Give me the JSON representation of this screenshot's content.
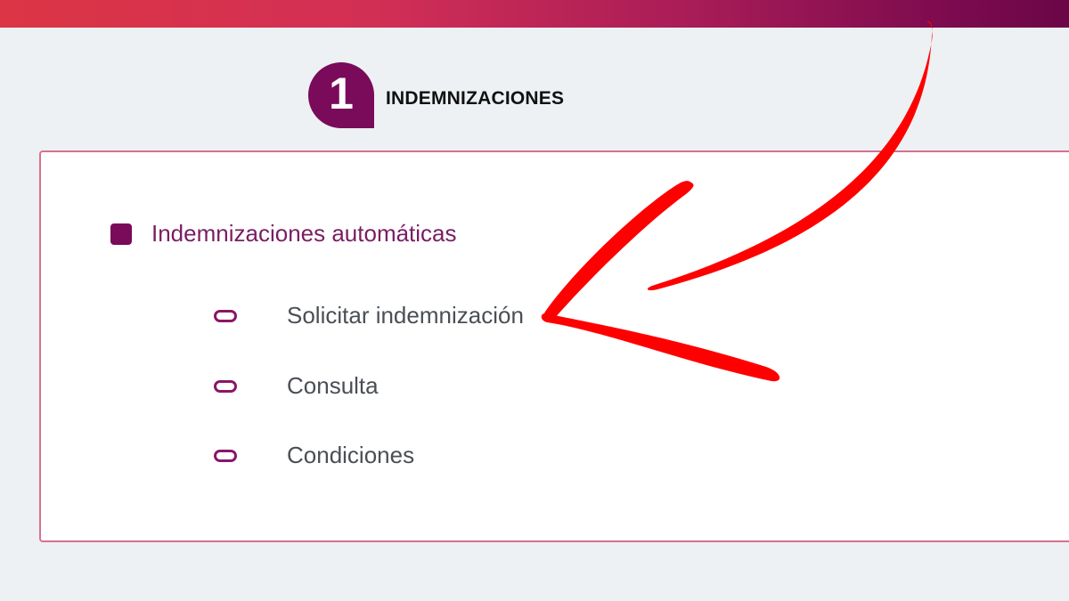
{
  "header": {
    "step_number": "1",
    "step_title": "INDEMNIZACIONES"
  },
  "section": {
    "label": "Indemnizaciones automáticas",
    "items": [
      {
        "label": "Solicitar indemnización"
      },
      {
        "label": "Consulta"
      },
      {
        "label": "Condiciones"
      }
    ]
  },
  "colors": {
    "brand_purple": "#7a0a5a",
    "panel_border": "#d8708e",
    "annotation_arrow": "#ff0000",
    "background": "#edf1f3"
  },
  "icons": {
    "section_bullet": "square-bullet-icon",
    "item_bullet": "pill-bullet-icon",
    "annotation": "red-arrow-annotation"
  }
}
